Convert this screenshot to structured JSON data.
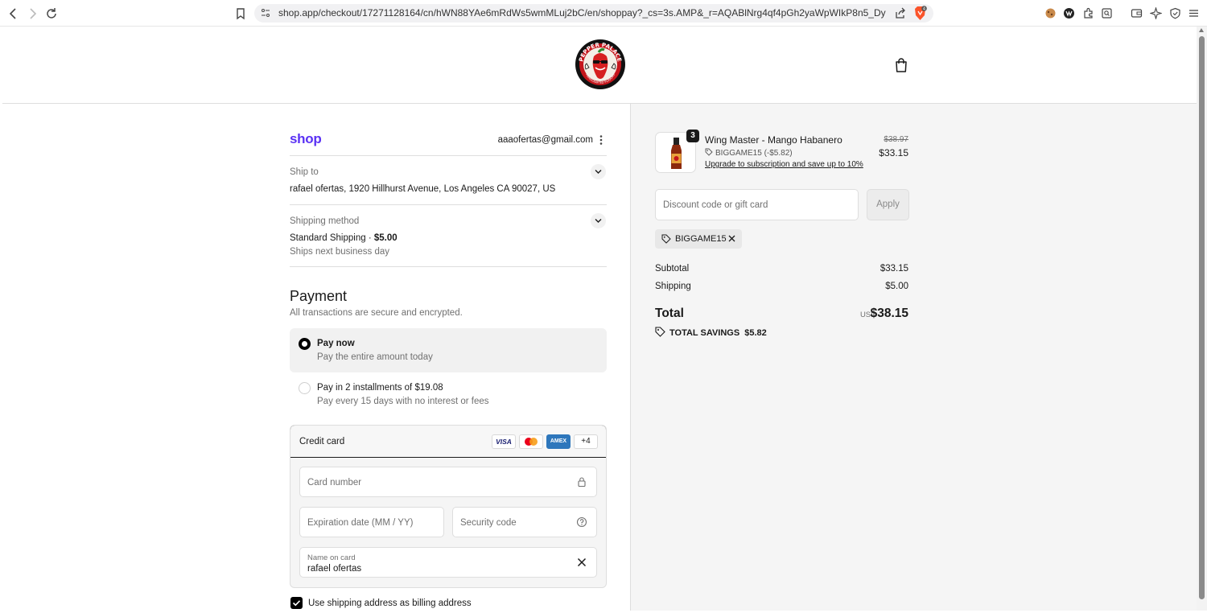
{
  "browser": {
    "url": "shop.app/checkout/17271128164/cn/hWN88YAe6mRdWs5wmMLuj2bC/en/shoppay?_cs=3s.AMP&_r=AQABlNrg4qf4pGh2yaWpWIkP8n5_DygRkOu_wRdF...",
    "brave_badge": "4"
  },
  "header": {
    "logo_text": "PEPPER PALACE",
    "logo_sub": "HANDCRAFTED FLAVORS"
  },
  "checkout": {
    "shop_brand": "shop",
    "account_email": "aaaofertas@gmail.com",
    "ship_to": {
      "label": "Ship to",
      "value": "rafael ofertas, 1920 Hillhurst Avenue, Los Angeles CA 90027, US"
    },
    "shipping_method": {
      "label": "Shipping method",
      "value": "Standard Shipping · ",
      "price": "$5.00",
      "sub": "Ships next business day"
    },
    "payment": {
      "title": "Payment",
      "subtitle": "All transactions are secure and encrypted.",
      "options": [
        {
          "title": "Pay now",
          "sub": "Pay the entire amount today",
          "selected": true
        },
        {
          "title": "Pay in 2 installments of $19.08",
          "sub": "Pay every 15 days with no interest or fees",
          "selected": false
        }
      ],
      "credit_card": {
        "label": "Credit card",
        "brands": [
          "VISA",
          "",
          "AMEX",
          "+4"
        ],
        "card_number_placeholder": "Card number",
        "expiration_placeholder": "Expiration date (MM / YY)",
        "security_placeholder": "Security code",
        "name_label": "Name on card",
        "name_value": "rafael ofertas"
      },
      "billing_checkbox": "Use shipping address as billing address"
    }
  },
  "order": {
    "item": {
      "qty": "3",
      "name": "Wing Master - Mango Habanero",
      "discount": "BIGGAME15 (-$5.82)",
      "upgrade": "Upgrade to subscription and save up to 10%",
      "old_price": "$38.97",
      "price": "$33.15"
    },
    "discount_placeholder": "Discount code or gift card",
    "apply_label": "Apply",
    "applied_code": "BIGGAME15",
    "subtotal_label": "Subtotal",
    "subtotal": "$33.15",
    "shipping_label": "Shipping",
    "shipping": "$5.00",
    "total_label": "Total",
    "currency": "USD",
    "total": "$38.15",
    "savings_label": "TOTAL SAVINGS",
    "savings": "$5.82"
  },
  "colors": {
    "shop_purple": "#5a31f4",
    "right_bg": "#f5f5f5",
    "text": "#1a1a1a"
  }
}
